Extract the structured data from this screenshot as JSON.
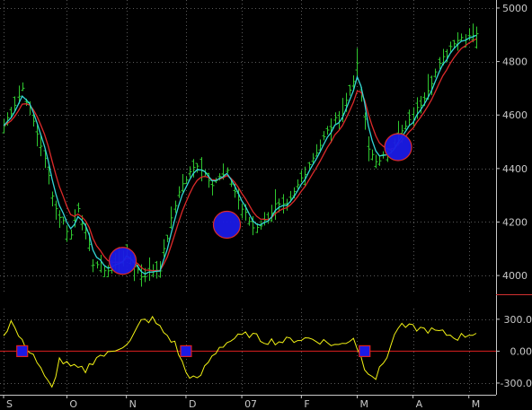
{
  "colors": {
    "background": "#000000",
    "grid": "#5a5a5a",
    "axis_text": "#c8c8c8",
    "price_bars": "#2fc82f",
    "fast_ma": "#33d6d6",
    "slow_ma": "#dd2a2a",
    "highlight_circle": "#1a1ae6",
    "oscillator": "#f2f214",
    "zero_line": "#e02020",
    "signal_box_fill": "#1a1ae6",
    "signal_box_border": "#e02020",
    "separator": "#d23030"
  },
  "chart_data": [
    {
      "type": "ohlc",
      "name": "price-panel",
      "ylim": [
        3930,
        5030
      ],
      "y_ticks": [
        "4000",
        "4200",
        "4400",
        "4600",
        "4800",
        "5000"
      ],
      "x_ticks": [
        "S",
        "O",
        "N",
        "D",
        "07",
        "F",
        "M",
        "A",
        "M"
      ],
      "n_bars": 128,
      "anchors": [
        [
          0,
          4560
        ],
        [
          5,
          4700
        ],
        [
          10,
          4490
        ],
        [
          14,
          4250
        ],
        [
          18,
          4150
        ],
        [
          20,
          4260
        ],
        [
          24,
          4050
        ],
        [
          28,
          4020
        ],
        [
          33,
          4080
        ],
        [
          37,
          4000
        ],
        [
          42,
          4030
        ],
        [
          47,
          4320
        ],
        [
          52,
          4420
        ],
        [
          56,
          4350
        ],
        [
          60,
          4380
        ],
        [
          64,
          4250
        ],
        [
          67,
          4180
        ],
        [
          70,
          4200
        ],
        [
          73,
          4260
        ],
        [
          76,
          4250
        ],
        [
          82,
          4420
        ],
        [
          88,
          4560
        ],
        [
          91,
          4610
        ],
        [
          95,
          4780
        ],
        [
          98,
          4470
        ],
        [
          101,
          4420
        ],
        [
          104,
          4480
        ],
        [
          110,
          4590
        ],
        [
          116,
          4760
        ],
        [
          121,
          4880
        ],
        [
          127,
          4910
        ]
      ],
      "highlights": [
        {
          "x": 32,
          "y": 4055
        },
        {
          "x": 60,
          "y": 4190
        },
        {
          "x": 106,
          "y": 4480
        }
      ]
    },
    {
      "type": "line",
      "name": "oscillator-panel",
      "ylim": [
        -410,
        400
      ],
      "y_ticks": [
        "300.0",
        "0.00",
        "-300.0"
      ],
      "anchors": [
        [
          0,
          150
        ],
        [
          2,
          280
        ],
        [
          5,
          80
        ],
        [
          8,
          -30
        ],
        [
          11,
          -250
        ],
        [
          13,
          -350
        ],
        [
          15,
          -80
        ],
        [
          18,
          -150
        ],
        [
          22,
          -180
        ],
        [
          25,
          -50
        ],
        [
          28,
          -30
        ],
        [
          31,
          40
        ],
        [
          34,
          90
        ],
        [
          37,
          280
        ],
        [
          40,
          300
        ],
        [
          43,
          180
        ],
        [
          46,
          70
        ],
        [
          49,
          -200
        ],
        [
          52,
          -280
        ],
        [
          55,
          -100
        ],
        [
          58,
          40
        ],
        [
          62,
          120
        ],
        [
          66,
          160
        ],
        [
          70,
          100
        ],
        [
          74,
          90
        ],
        [
          78,
          110
        ],
        [
          82,
          120
        ],
        [
          86,
          90
        ],
        [
          90,
          50
        ],
        [
          94,
          130
        ],
        [
          97,
          -150
        ],
        [
          100,
          -250
        ],
        [
          103,
          -40
        ],
        [
          106,
          230
        ],
        [
          110,
          220
        ],
        [
          114,
          200
        ],
        [
          118,
          170
        ],
        [
          122,
          130
        ],
        [
          127,
          180
        ]
      ],
      "signal_markers": [
        {
          "x": 5,
          "y": 0
        },
        {
          "x": 49,
          "y": 0
        },
        {
          "x": 97,
          "y": 0
        }
      ]
    }
  ]
}
